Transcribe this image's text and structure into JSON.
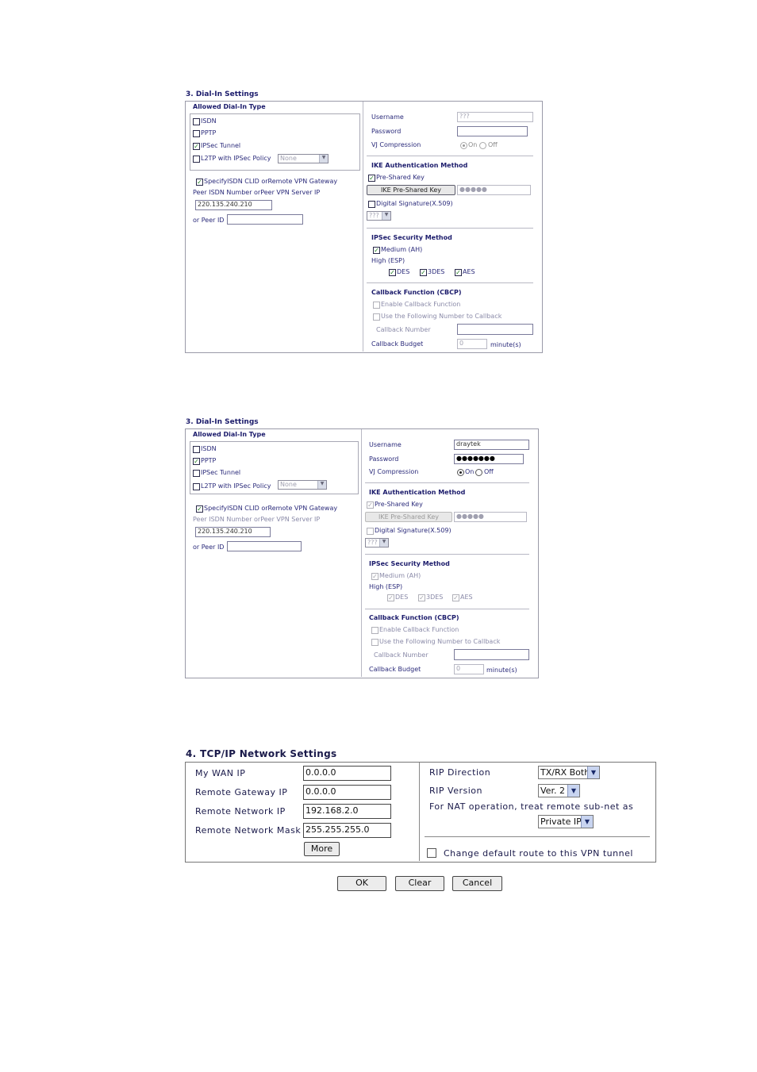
{
  "panel1": {
    "title": "3. Dial-In Settings",
    "allowed_header": "Allowed Dial-In Type",
    "types": [
      {
        "label": "ISDN",
        "checked": false
      },
      {
        "label": "PPTP",
        "checked": false
      },
      {
        "label": "IPSec Tunnel",
        "checked": true
      },
      {
        "label": "L2TP with IPSec Policy",
        "checked": false
      }
    ],
    "l2tp_policy": "None",
    "specify_label": "SpecifyISDN CLID orRemote VPN Gateway",
    "peer_label": "Peer ISDN Number orPeer VPN Server IP",
    "peer_ip": "220.135.240.210",
    "peer_id_label": "or Peer ID",
    "peer_id": "",
    "username_label": "Username",
    "username": "???",
    "password_label": "Password",
    "password": "",
    "vj_label": "VJ Compression",
    "on": "On",
    "off": "Off",
    "ike_header": "IKE Authentication Method",
    "pre_shared": "Pre-Shared Key",
    "ike_btn": "IKE Pre-Shared Key",
    "ike_key": "●●●●●",
    "digital_sig": "Digital Signature(X.509)",
    "sig_select": "???",
    "ipsec_header": "IPSec Security Method",
    "medium": "Medium (AH)",
    "high": "High (ESP)",
    "des": "DES",
    "3des": "3DES",
    "aes": "AES",
    "callback_header": "Callback Function (CBCP)",
    "enable_cb": "Enable Callback Function",
    "use_following": "Use the Following Number to Callback",
    "cb_number_label": "Callback Number",
    "cb_budget_label": "Callback Budget",
    "cb_budget": "0",
    "minutes": "minute(s)"
  },
  "panel2": {
    "title": "3. Dial-In Settings",
    "allowed_header": "Allowed Dial-In Type",
    "types": [
      {
        "label": "ISDN",
        "checked": false
      },
      {
        "label": "PPTP",
        "checked": true
      },
      {
        "label": "IPSec Tunnel",
        "checked": false
      },
      {
        "label": "L2TP with IPSec Policy",
        "checked": false
      }
    ],
    "l2tp_policy": "None",
    "specify_label": "SpecifyISDN CLID orRemote VPN Gateway",
    "peer_label": "Peer ISDN Number orPeer VPN Server IP",
    "peer_ip": "220.135.240.210",
    "peer_id_label": "or Peer ID",
    "peer_id": "",
    "username_label": "Username",
    "username": "draytek",
    "password_label": "Password",
    "password": "●●●●●●●",
    "vj_label": "VJ Compression",
    "on": "On",
    "off": "Off",
    "ike_header": "IKE Authentication Method",
    "pre_shared": "Pre-Shared Key",
    "ike_btn": "IKE Pre-Shared Key",
    "ike_key": "●●●●●",
    "digital_sig": "Digital Signature(X.509)",
    "sig_select": "???",
    "ipsec_header": "IPSec Security Method",
    "medium": "Medium (AH)",
    "high": "High (ESP)",
    "des": "DES",
    "3des": "3DES",
    "aes": "AES",
    "callback_header": "Callback Function (CBCP)",
    "enable_cb": "Enable Callback Function",
    "use_following": "Use the Following Number to Callback",
    "cb_number_label": "Callback Number",
    "cb_budget_label": "Callback Budget",
    "cb_budget": "0",
    "minutes": "minute(s)"
  },
  "tcpip": {
    "title": "4. TCP/IP Network Settings",
    "my_wan_label": "My WAN IP",
    "my_wan": "0.0.0.0",
    "remote_gw_label": "Remote Gateway IP",
    "remote_gw": "0.0.0.0",
    "remote_net_label": "Remote Network IP",
    "remote_net": "192.168.2.0",
    "remote_mask_label": "Remote Network Mask",
    "remote_mask": "255.255.255.0",
    "more_btn": "More",
    "rip_dir_label": "RIP Direction",
    "rip_dir": "TX/RX Both",
    "rip_ver_label": "RIP Version",
    "rip_ver": "Ver. 2",
    "nat_label": "For NAT operation, treat remote sub-net as",
    "nat_value": "Private IP",
    "default_route": "Change default route to this VPN tunnel"
  },
  "actions": {
    "ok": "OK",
    "clear": "Clear",
    "cancel": "Cancel"
  }
}
